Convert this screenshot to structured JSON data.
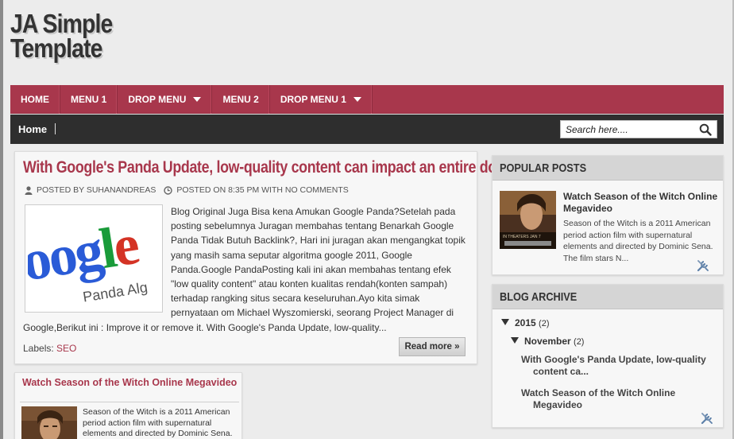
{
  "site": {
    "title_line1": "JA Simple",
    "title_line2": "Template"
  },
  "menu": [
    {
      "label": "HOME",
      "dropdown": false
    },
    {
      "label": "MENU 1",
      "dropdown": false
    },
    {
      "label": "DROP MENU",
      "dropdown": true
    },
    {
      "label": "MENU 2",
      "dropdown": false
    },
    {
      "label": "DROP MENU 1",
      "dropdown": true
    }
  ],
  "subbar": {
    "breadcrumb": "Home",
    "search_placeholder": "Search here...."
  },
  "main_post": {
    "title": "With Google's Panda Update, low-quality content can impact an entire domain",
    "author_meta": "POSTED BY SUHANANDREAS",
    "time_meta": "POSTED ON 8:35 PM WITH NO COMMENTS",
    "image_text": {
      "google": "oogle",
      "panda": "Panda Alg"
    },
    "excerpt": "Blog Original Juga Bisa kena Amukan Google Panda?Setelah pada posting sebelumnya Juragan membahas tentang Benarkah Google Panda Tidak Butuh Backlink?, Hari ini juragan akan mengangkat topik yang masih sama seputar algoritma google 2011, Google Panda.Google PandaPosting kali ini akan membahas tentang efek \"low quality content\" atau konten kualitas rendah(konten sampah) terhadap rangking situs secara keseluruhan.Ayo kita simak pernyataan om Michael Wyszomierski, seorang Project Manager di Google,Berikut ini :     Improve it or remove it. With Google's Panda Update, low-quality...",
    "labels_prefix": "Labels:",
    "label": "SEO",
    "read_more": "Read more »"
  },
  "second_post": {
    "title": "Watch Season of the Witch Online Megavideo",
    "snippet": "Season of the Witch is a 2011 American period action film with supernatural elements and directed by Dominic Sena."
  },
  "popular_posts": {
    "heading": "POPULAR POSTS",
    "item_title": "Watch Season of the Witch Online Megavideo",
    "item_snippet": "Season of the Witch is a 2011 American period action film with supernatural elements and directed by Dominic Sena. The film stars N...",
    "thumb_text": "IN THEATERS JAN 7"
  },
  "blog_archive": {
    "heading": "BLOG ARCHIVE",
    "year": "2015",
    "year_count": "(2)",
    "month": "November",
    "month_count": "(2)",
    "posts": [
      {
        "line1": "With Google's Panda Update, low-quality",
        "line2": "content ca..."
      },
      {
        "line1": "Watch Season of the Witch Online",
        "line2": "Megavideo"
      }
    ]
  },
  "colors": {
    "accent": "#a8374c",
    "subbar": "#2e2e2e",
    "background": "#ececec"
  }
}
